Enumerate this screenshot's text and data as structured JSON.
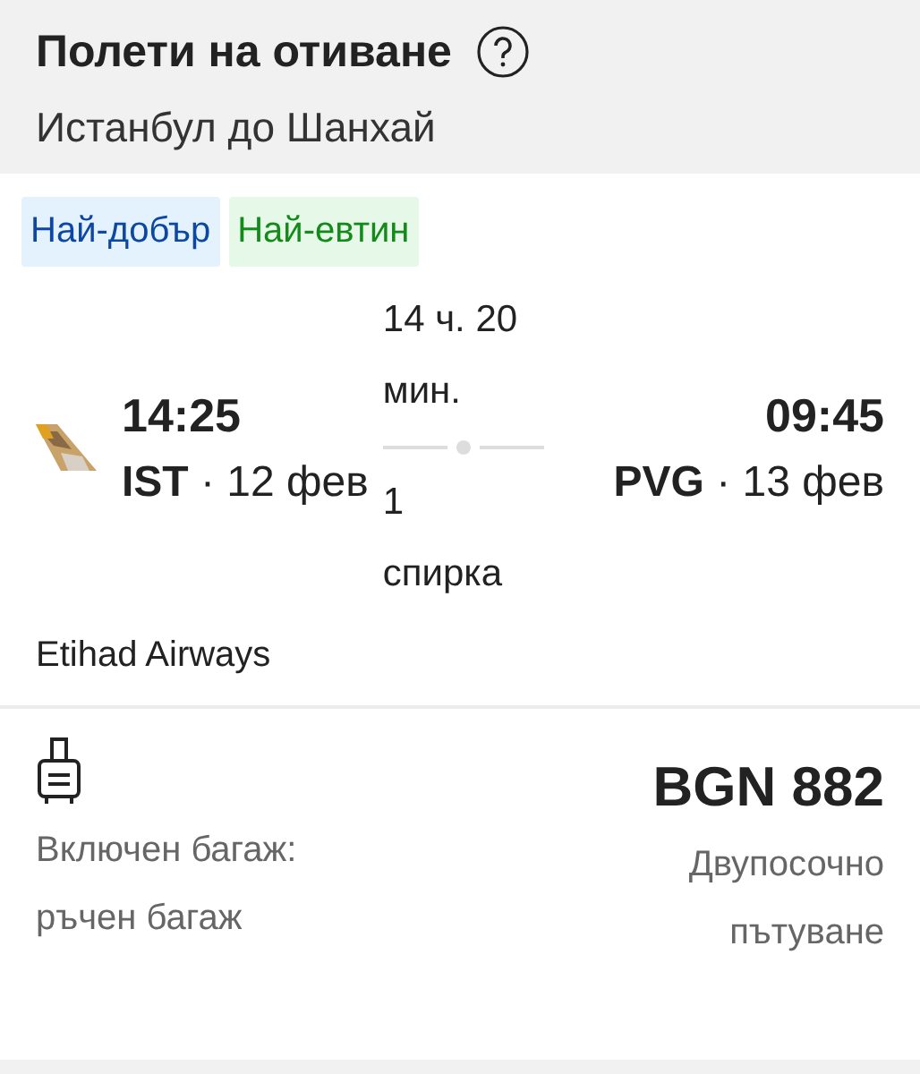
{
  "header": {
    "title": "Полети на отиване",
    "route": "Истанбул до Шанхай"
  },
  "tags": [
    {
      "label": "Най-добър",
      "kind": "best"
    },
    {
      "label": "Най-евтин",
      "kind": "cheapest"
    }
  ],
  "flight": {
    "departure": {
      "time": "14:25",
      "place": "**IST** · 12 фев"
    },
    "duration": "14 ч. 20 мин.",
    "stops": "1 спирка",
    "arrival": {
      "time": "09:45",
      "place": "**PVG** · 13 фев"
    },
    "airline": "Etihad Airways"
  },
  "fare": {
    "baggage": "Включен багаж: ръчен багаж",
    "price": "BGN 882",
    "trip_type": "Двупосочно пътуване"
  }
}
